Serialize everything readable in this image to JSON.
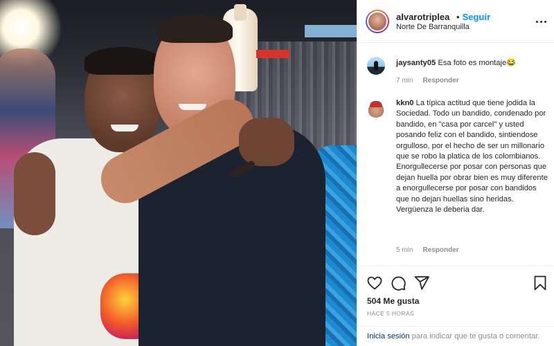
{
  "header": {
    "username": "alvarotriplea",
    "separator": "•",
    "follow_label": "Seguir",
    "location": "Norte De Barranquilla"
  },
  "comments": [
    {
      "username": "jaysanty05",
      "text": "Esa foto es montaje😂",
      "time": "7 min",
      "reply_label": "Responder"
    },
    {
      "username": "kkn0",
      "text": "La típica actitud que tiene jodida la Sociedad. Todo un bandido, condenado por bandido, en \"casa por carcel\" y usted posando feliz con el bandido, sintiendose orgulloso, por el hecho de ser un millonario que se robo la platica de los colombianos. Enorgullecerse por posar con personas que dejan huella por obrar bien es muy diferente a enorgullecerse por posar con bandidos que no dejan huellas sino heridas. Vergüenza le deberia dar.",
      "time": "5 min",
      "reply_label": "Responder"
    }
  ],
  "actions": {
    "icons": [
      "heart-icon",
      "comment-icon",
      "share-icon",
      "bookmark-icon"
    ],
    "likes": "504 Me gusta",
    "time_ago": "HACE 5 HORAS"
  },
  "login_prompt": {
    "link": "Inicia sesión",
    "rest": " para indicar que te gusta o comentar."
  },
  "colors": {
    "accent": "#0095f6",
    "text": "#262626",
    "muted": "#8e8e8e",
    "link": "#00376b"
  }
}
